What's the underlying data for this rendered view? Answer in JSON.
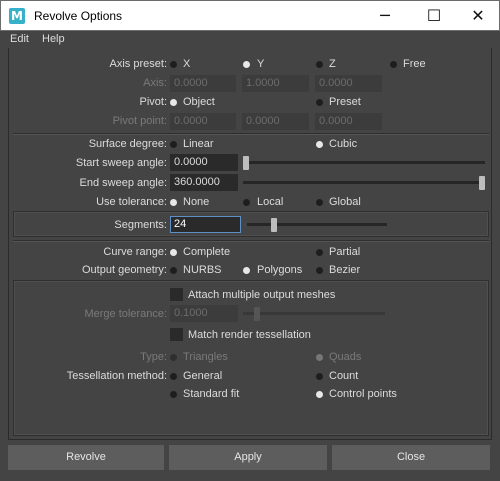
{
  "window": {
    "title": "Revolve Options",
    "app_icon_letter": "M",
    "minimize_glyph": "─",
    "maximize_glyph": "☐",
    "close_glyph": "✕"
  },
  "menu": {
    "items": [
      "Edit",
      "Help"
    ]
  },
  "axis_preset": {
    "label": "Axis preset:",
    "options": [
      "X",
      "Y",
      "Z",
      "Free"
    ],
    "selected": "Y"
  },
  "axis": {
    "label": "Axis:",
    "values": [
      "0.0000",
      "1.0000",
      "0.0000"
    ]
  },
  "pivot": {
    "label": "Pivot:",
    "options": [
      "Object",
      "Preset"
    ],
    "selected": "Object"
  },
  "pivot_point": {
    "label": "Pivot point:",
    "values": [
      "0.0000",
      "0.0000",
      "0.0000"
    ]
  },
  "surface_degree": {
    "label": "Surface degree:",
    "options": [
      "Linear",
      "Cubic"
    ],
    "selected": "Cubic"
  },
  "start_sweep": {
    "label": "Start sweep angle:",
    "value": "0.0000",
    "slider_fraction": 0.0
  },
  "end_sweep": {
    "label": "End sweep angle:",
    "value": "360.0000",
    "slider_fraction": 1.0
  },
  "use_tolerance": {
    "label": "Use tolerance:",
    "options": [
      "None",
      "Local",
      "Global"
    ],
    "selected": "None"
  },
  "segments": {
    "label": "Segments:",
    "value": "24",
    "slider_fraction": 0.18
  },
  "curve_range": {
    "label": "Curve range:",
    "options": [
      "Complete",
      "Partial"
    ],
    "selected": "Complete"
  },
  "output_geometry": {
    "label": "Output geometry:",
    "options": [
      "NURBS",
      "Polygons",
      "Bezier"
    ],
    "selected": "Polygons"
  },
  "attach_meshes": {
    "label": "Attach multiple output meshes",
    "checked": false
  },
  "merge_tolerance": {
    "label": "Merge tolerance:",
    "value": "0.1000",
    "slider_fraction": 0.08
  },
  "match_render": {
    "label": "Match render tessellation",
    "checked": false
  },
  "type": {
    "label": "Type:",
    "options": [
      "Triangles",
      "Quads"
    ],
    "selected": "Quads"
  },
  "tessellation_method": {
    "label": "Tessellation method:",
    "options": [
      "General",
      "Count",
      "Standard fit",
      "Control points"
    ],
    "selected": "Control points"
  },
  "buttons": {
    "revolve": "Revolve",
    "apply": "Apply",
    "close": "Close"
  }
}
